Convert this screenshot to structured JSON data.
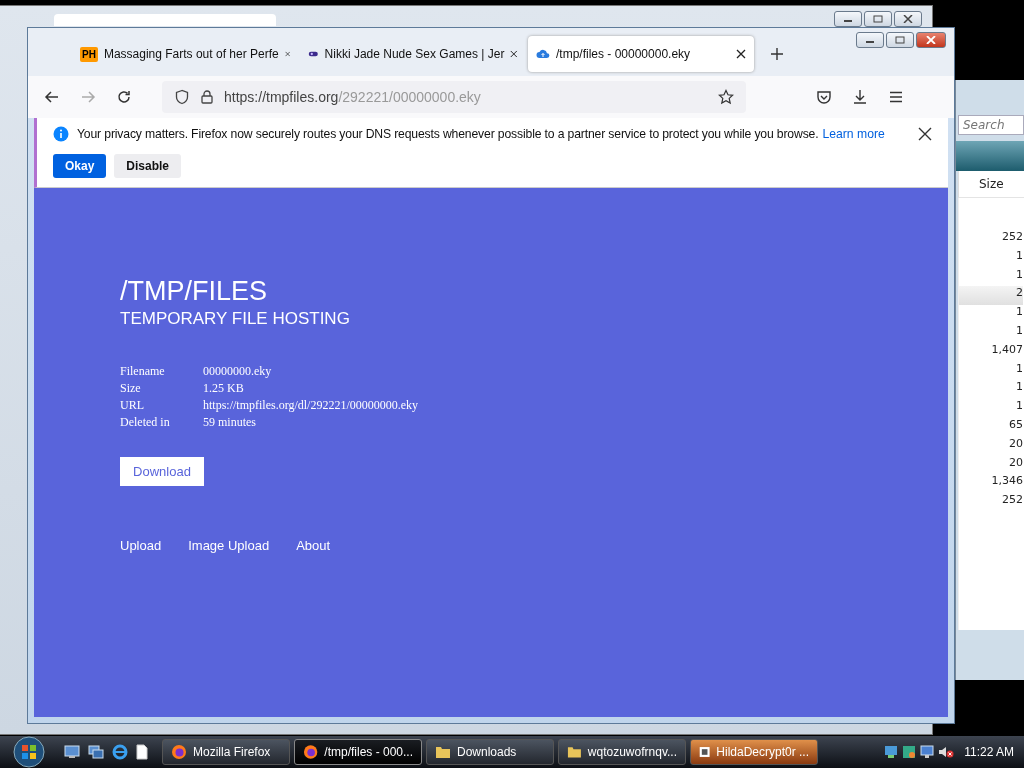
{
  "explorer_window": {
    "search": {
      "placeholder": "Search"
    },
    "column": "Size",
    "sizes": [
      {
        "text": "252",
        "selected": false
      },
      {
        "text": "1",
        "selected": false
      },
      {
        "text": "1",
        "selected": false
      },
      {
        "text": "2",
        "selected": true
      },
      {
        "text": "1",
        "selected": false
      },
      {
        "text": "1",
        "selected": false
      },
      {
        "text": "1,407",
        "selected": false
      },
      {
        "text": "1",
        "selected": false
      },
      {
        "text": "1",
        "selected": false
      },
      {
        "text": "1",
        "selected": false
      },
      {
        "text": "65",
        "selected": false
      },
      {
        "text": "20",
        "selected": false
      },
      {
        "text": "20",
        "selected": false
      },
      {
        "text": "1,346",
        "selected": false
      },
      {
        "text": "252",
        "selected": false
      }
    ]
  },
  "firefox_window": {
    "tabs": [
      {
        "badge": "PH",
        "title": "Massaging Farts out of her Perfe",
        "selected": false
      },
      {
        "title": "Nikki Jade Nude Sex Games | Jer",
        "selected": false
      },
      {
        "title": "/tmp/files - 00000000.eky",
        "selected": true
      }
    ],
    "url_host": "https://tmpfiles.org",
    "url_path": "/292221/00000000.eky",
    "notification": {
      "text": "Your privacy matters. Firefox now securely routes your DNS requests whenever possible to a partner service to protect you while you browse.",
      "link": "Learn more",
      "buttons": [
        {
          "label": "Okay",
          "kind": "primary"
        },
        {
          "label": "Disable",
          "kind": "secondary"
        }
      ]
    },
    "page": {
      "title": "/TMP/FILES",
      "subtitle": "TEMPORARY FILE HOSTING",
      "details": [
        {
          "label": "Filename",
          "value": "00000000.eky"
        },
        {
          "label": "Size",
          "value": "1.25 KB"
        },
        {
          "label": "URL",
          "value": "https://tmpfiles.org/dl/292221/00000000.eky"
        },
        {
          "label": "Deleted in",
          "value": "59 minutes"
        }
      ],
      "download": "Download",
      "links": [
        "Upload",
        "Image Upload",
        "About"
      ]
    }
  },
  "taskbar": {
    "buttons": [
      {
        "label": "Mozilla Firefox",
        "selected": false,
        "attention": false
      },
      {
        "label": "/tmp/files - 000...",
        "selected": true,
        "attention": false
      },
      {
        "label": "Downloads",
        "selected": false,
        "attention": false
      },
      {
        "label": "wqtozuwofrnqv...",
        "selected": false,
        "attention": false
      },
      {
        "label": "HildaDecrypt0r ...",
        "selected": false,
        "attention": true
      }
    ],
    "clock": "11:22 AM"
  }
}
